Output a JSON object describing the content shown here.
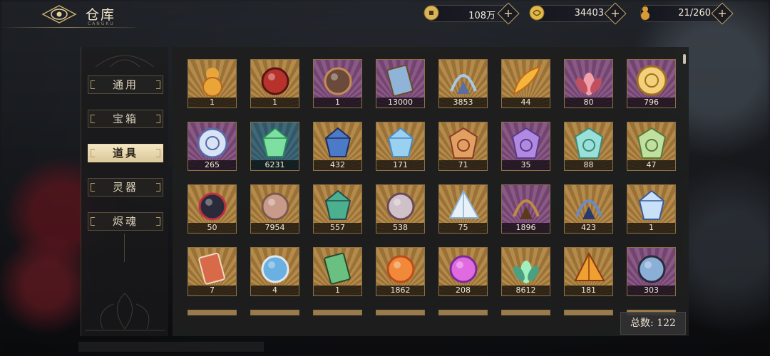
{
  "header": {
    "title": "仓库",
    "subtitle": "CANGKU",
    "currencies": [
      {
        "icon": "copper-coin-icon",
        "value": "108万",
        "color": "#d8b55a"
      },
      {
        "icon": "gold-dragon-coin-icon",
        "value": "34403",
        "color": "#e0b94a"
      },
      {
        "icon": "gourd-icon",
        "value": "21/260",
        "color": "#d99a35"
      }
    ]
  },
  "sidebar": {
    "tabs": [
      {
        "label": "通用",
        "active": false
      },
      {
        "label": "宝箱",
        "active": false
      },
      {
        "label": "道具",
        "active": true
      },
      {
        "label": "灵器",
        "active": false
      },
      {
        "label": "烬魂",
        "active": false
      }
    ]
  },
  "items": [
    {
      "name": "gourd-item",
      "count": "1",
      "rarity": "gold",
      "icon": "gourd-icon",
      "c1": "#e9a43a",
      "c2": "#b9651c"
    },
    {
      "name": "red-mask-figure-item",
      "count": "1",
      "rarity": "gold",
      "icon": "red-mask-icon",
      "c1": "#b8322c",
      "c2": "#5a1414"
    },
    {
      "name": "chibi-character-item",
      "count": "1",
      "rarity": "purple",
      "icon": "chibi-character-icon",
      "c1": "#6a4a3a",
      "c2": "#c68b52"
    },
    {
      "name": "scroll-tickets-item",
      "count": "13000",
      "rarity": "purple",
      "icon": "scroll-tickets-icon",
      "c1": "#8fb4d8",
      "c2": "#6a4b2a"
    },
    {
      "name": "crystal-bell-item",
      "count": "3853",
      "rarity": "gold",
      "icon": "crystal-bell-icon",
      "c1": "#a8c8e8",
      "c2": "#5c6ea0"
    },
    {
      "name": "golden-feather-item",
      "count": "44",
      "rarity": "gold",
      "icon": "golden-feather-icon",
      "c1": "#f3b53a",
      "c2": "#c06a1a"
    },
    {
      "name": "pink-petal-item",
      "count": "80",
      "rarity": "purple",
      "icon": "pink-petal-icon",
      "c1": "#f0a0a8",
      "c2": "#c05060"
    },
    {
      "name": "golden-disc-item",
      "count": "796",
      "rarity": "purple",
      "icon": "golden-disc-icon",
      "c1": "#f3d07a",
      "c2": "#a07020"
    },
    {
      "name": "blue-medallion-item",
      "count": "265",
      "rarity": "purple",
      "icon": "blue-medallion-icon",
      "c1": "#d8e4f4",
      "c2": "#5a6aa8"
    },
    {
      "name": "green-jade-item",
      "count": "6231",
      "rarity": "blue",
      "icon": "green-jade-icon",
      "c1": "#7ee0a0",
      "c2": "#2a8a5a"
    },
    {
      "name": "blue-gem-item",
      "count": "432",
      "rarity": "gold",
      "icon": "blue-gem-icon",
      "c1": "#4a7ac8",
      "c2": "#1e2e5a"
    },
    {
      "name": "crystal-shard-item",
      "count": "171",
      "rarity": "gold",
      "icon": "crystal-shard-icon",
      "c1": "#9ad0f0",
      "c2": "#4a8ac8"
    },
    {
      "name": "talisman-red-item",
      "count": "71",
      "rarity": "gold",
      "icon": "talisman-icon",
      "c1": "#e0a060",
      "c2": "#8a3a2a"
    },
    {
      "name": "talisman-purple-item",
      "count": "35",
      "rarity": "purple",
      "icon": "talisman-icon",
      "c1": "#b08ae0",
      "c2": "#5a3a8a"
    },
    {
      "name": "talisman-cyan-item",
      "count": "88",
      "rarity": "gold",
      "icon": "talisman-icon",
      "c1": "#9ae0d8",
      "c2": "#3a8a7a"
    },
    {
      "name": "talisman-green-item",
      "count": "47",
      "rarity": "gold",
      "icon": "talisman-icon",
      "c1": "#c0e0a0",
      "c2": "#5a7a3a"
    },
    {
      "name": "star-cube-item",
      "count": "50",
      "rarity": "gold",
      "icon": "star-cube-icon",
      "c1": "#2a2a3a",
      "c2": "#c03040"
    },
    {
      "name": "lotus-seed-item",
      "count": "7954",
      "rarity": "gold",
      "icon": "seed-pod-icon",
      "c1": "#c89a8a",
      "c2": "#7a5a4a"
    },
    {
      "name": "jade-dragon-item",
      "count": "557",
      "rarity": "gold",
      "icon": "jade-dragon-icon",
      "c1": "#4ab090",
      "c2": "#2a4a4a"
    },
    {
      "name": "spirit-orb-item",
      "count": "538",
      "rarity": "gold",
      "icon": "spirit-orb-icon",
      "c1": "#d0c0c8",
      "c2": "#6a4a5a"
    },
    {
      "name": "crystal-prism-item",
      "count": "75",
      "rarity": "gold",
      "icon": "prism-icon",
      "c1": "#e8f0f8",
      "c2": "#8ab0d0"
    },
    {
      "name": "bronze-bell-item",
      "count": "1896",
      "rarity": "purple",
      "icon": "bronze-bell-icon",
      "c1": "#c08a40",
      "c2": "#5a3a1a"
    },
    {
      "name": "blue-bell-item",
      "count": "423",
      "rarity": "gold",
      "icon": "blue-bell-icon",
      "c1": "#6a8ac8",
      "c2": "#2a3a6a"
    },
    {
      "name": "ice-crystal-item",
      "count": "1",
      "rarity": "gold",
      "icon": "ice-crystal-icon",
      "c1": "#c8e0f8",
      "c2": "#3a5a9a"
    },
    {
      "name": "red-scroll-item",
      "count": "7",
      "rarity": "gold",
      "icon": "red-scroll-icon",
      "c1": "#d86a4a",
      "c2": "#f0d8c0"
    },
    {
      "name": "blue-fan-item",
      "count": "4",
      "rarity": "gold",
      "icon": "blue-fan-icon",
      "c1": "#6ab0e0",
      "c2": "#e0e8f0"
    },
    {
      "name": "green-tablet-item",
      "count": "1",
      "rarity": "gold",
      "icon": "green-tablet-icon",
      "c1": "#6ac080",
      "c2": "#2a4a2a"
    },
    {
      "name": "fire-orb-item",
      "count": "1862",
      "rarity": "gold",
      "icon": "fire-orb-icon",
      "c1": "#f08a3a",
      "c2": "#c04a1a"
    },
    {
      "name": "purple-flame-item",
      "count": "208",
      "rarity": "gold",
      "icon": "purple-flame-icon",
      "c1": "#e06ae0",
      "c2": "#7a2a9a"
    },
    {
      "name": "jade-lotus-item",
      "count": "8612",
      "rarity": "gold",
      "icon": "lotus-icon",
      "c1": "#a0f0c0",
      "c2": "#4aa080"
    },
    {
      "name": "amber-pyramid-item",
      "count": "181",
      "rarity": "gold",
      "icon": "pyramid-icon",
      "c1": "#f0a030",
      "c2": "#8a3a10"
    },
    {
      "name": "bubble-creature-item",
      "count": "303",
      "rarity": "purple",
      "icon": "bubble-creature-icon",
      "c1": "#8ab0d8",
      "c2": "#2a2a3a"
    }
  ],
  "footer": {
    "total": "总数: 122"
  }
}
